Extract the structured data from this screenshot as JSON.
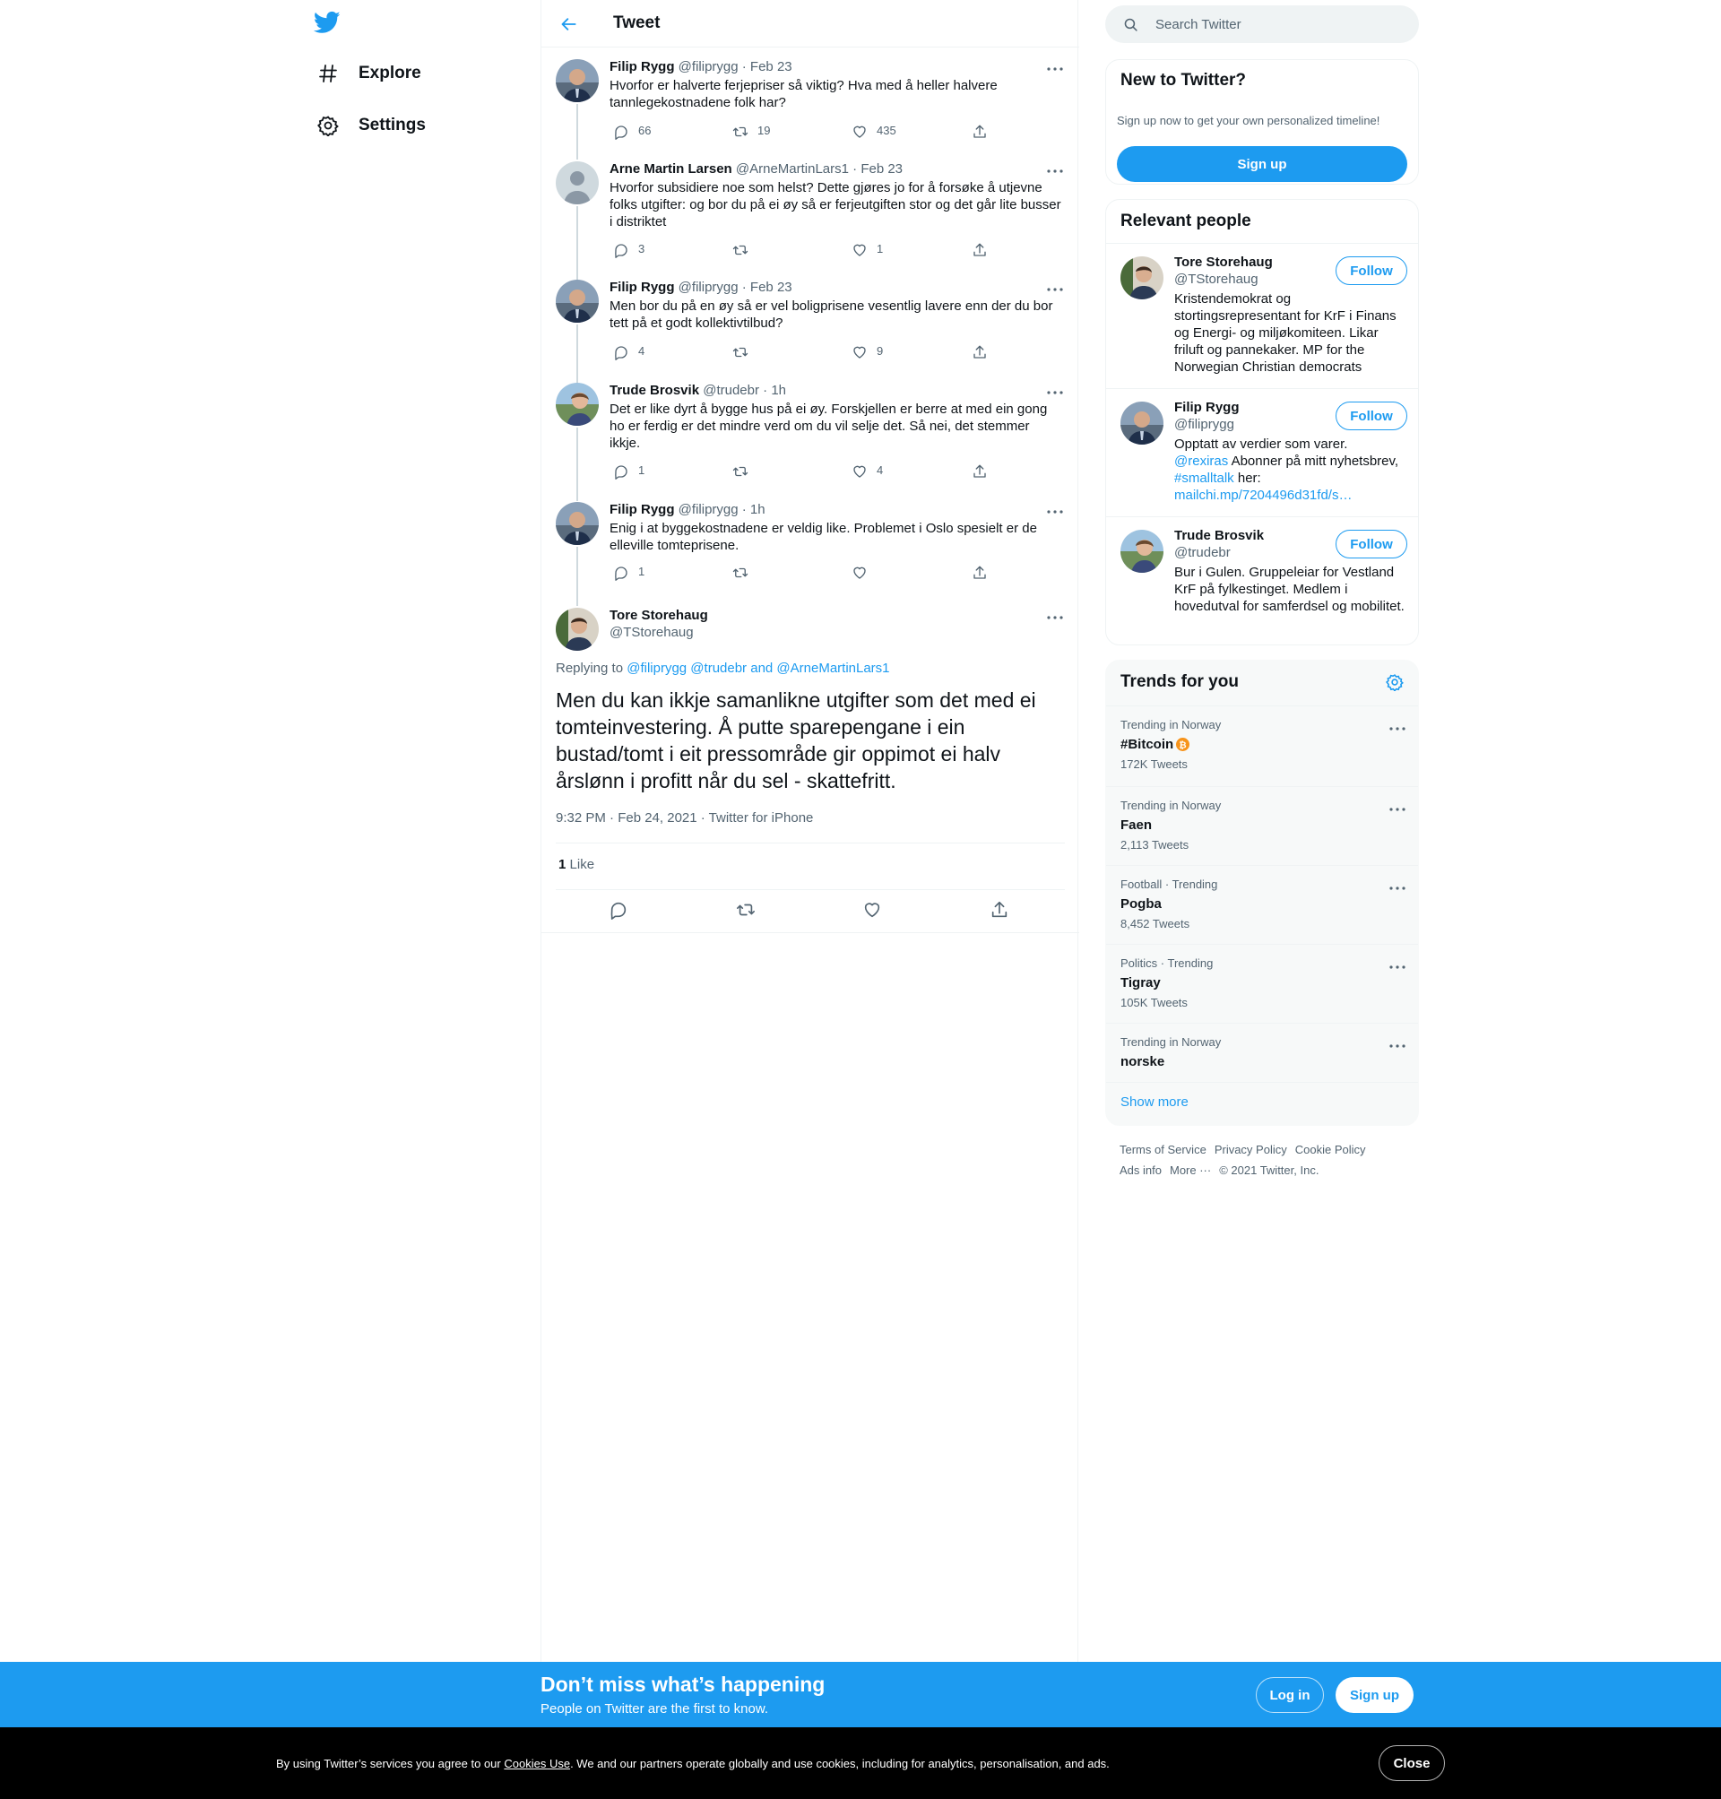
{
  "nav": {
    "items": [
      {
        "label": "Explore",
        "icon": "hashtag-icon"
      },
      {
        "label": "Settings",
        "icon": "gear-icon"
      }
    ]
  },
  "header": {
    "title": "Tweet"
  },
  "thread": [
    {
      "name": "Filip Rygg",
      "handle": "@filiprygg",
      "time": "· Feb 23",
      "text": "Hvorfor er halverte ferjepriser så viktig? Hva med å heller halvere tannlegekostnadene folk har?",
      "replies": "66",
      "retweets": "19",
      "likes": "435"
    },
    {
      "name": "Arne Martin Larsen",
      "handle": "@ArneMartinLars1",
      "time": "· Feb 23",
      "text": "Hvorfor subsidiere noe som helst? Dette gjøres jo for å forsøke å utjevne folks utgifter: og bor du på ei øy så er ferjeutgiften stor og det går lite busser i distriktet",
      "replies": "3",
      "retweets": "",
      "likes": "1"
    },
    {
      "name": "Filip Rygg",
      "handle": "@filiprygg",
      "time": "· Feb 23",
      "text": "Men bor du på en øy så er vel boligprisene vesentlig lavere enn der du bor tett på et godt kollektivtilbud?",
      "replies": "4",
      "retweets": "",
      "likes": "9"
    },
    {
      "name": "Trude Brosvik",
      "handle": "@trudebr",
      "time": "· 1h",
      "text": "Det er like dyrt å bygge hus på ei øy. Forskjellen er berre at med ein gong ho er ferdig er det mindre verd om du vil selje det. Så nei, det stemmer ikkje.",
      "replies": "1",
      "retweets": "",
      "likes": "4"
    },
    {
      "name": "Filip Rygg",
      "handle": "@filiprygg",
      "time": "· 1h",
      "text": "Enig i at byggekostnadene er veldig like. Problemet i Oslo spesielt er de elleville tomteprisene.",
      "replies": "1",
      "retweets": "",
      "likes": ""
    }
  ],
  "main_tweet": {
    "name": "Tore Storehaug",
    "handle": "@TStorehaug",
    "replying_prefix": "Replying to",
    "replying_to": "@filiprygg @trudebr and @ArneMartinLars1",
    "text": "Men du kan ikkje samanlikne utgifter som det med ei tomteinvestering. Å putte sparepengane i ein bustad/tomt i eit pressområde gir oppimot ei halv årslønn i profitt når du sel - skattefritt.",
    "timestamp": "9:32 PM · Feb 24, 2021 · Twitter for iPhone",
    "like_count": "1",
    "like_label": "Like"
  },
  "search": {
    "placeholder": "Search Twitter"
  },
  "new_to_twitter": {
    "title": "New to Twitter?",
    "subtitle": "Sign up now to get your own personalized timeline!",
    "button": "Sign up"
  },
  "relevant_people": {
    "title": "Relevant people",
    "follow_label": "Follow",
    "people": [
      {
        "name": "Tore Storehaug",
        "handle": "@TStorehaug",
        "bio": "Kristendemokrat og stortingsrepresentant for KrF i Finans og Energi- og miljøkomiteen. Likar friluft og pannekaker. MP for the Norwegian Christian democrats"
      },
      {
        "name": "Filip Rygg",
        "handle": "@filiprygg",
        "bio_1": "Opptatt av verdier som varer.",
        "bio_link_1": "@rexiras",
        "bio_2": " Abonner på mitt nyhetsbrev,",
        "bio_link_2": "#smalltalk",
        "bio_3": " her:",
        "bio_link_3": "mailchi.mp/7204496d31fd/s…"
      },
      {
        "name": "Trude Brosvik",
        "handle": "@trudebr",
        "bio": "Bur i Gulen. Gruppeleiar for Vestland KrF på fylkestinget. Medlem i hovedutval for samferdsel og mobilitet."
      }
    ]
  },
  "trends": {
    "title": "Trends for you",
    "items": [
      {
        "context": "Trending in Norway",
        "name": "#Bitcoin",
        "count": "172K Tweets"
      },
      {
        "context": "Trending in Norway",
        "name": "Faen",
        "count": "2,113 Tweets"
      },
      {
        "context": "Football · Trending",
        "name": "Pogba",
        "count": "8,452 Tweets"
      },
      {
        "context": "Politics · Trending",
        "name": "Tigray",
        "count": "105K Tweets"
      },
      {
        "context": "Trending in Norway",
        "name": "norske",
        "count": ""
      }
    ],
    "show_more": "Show more"
  },
  "footer": {
    "links": [
      "Terms of Service",
      "Privacy Policy",
      "Cookie Policy",
      "Ads info",
      "More ···"
    ],
    "copyright": "© 2021 Twitter, Inc."
  },
  "banner": {
    "title": "Don’t miss what’s happening",
    "subtitle": "People on Twitter are the first to know.",
    "login": "Log in",
    "signup": "Sign up"
  },
  "cookie": {
    "text_before": "By using Twitter’s services you agree to our ",
    "link": "Cookies Use",
    "text_after": ". We and our partners operate globally and use cookies, including for analytics, personalisation, and ads.",
    "close": "Close"
  },
  "colors": {
    "accent": "#1d9bf0",
    "text": "#0f1419",
    "muted": "#536471",
    "bitcoin": "#f7931a"
  }
}
